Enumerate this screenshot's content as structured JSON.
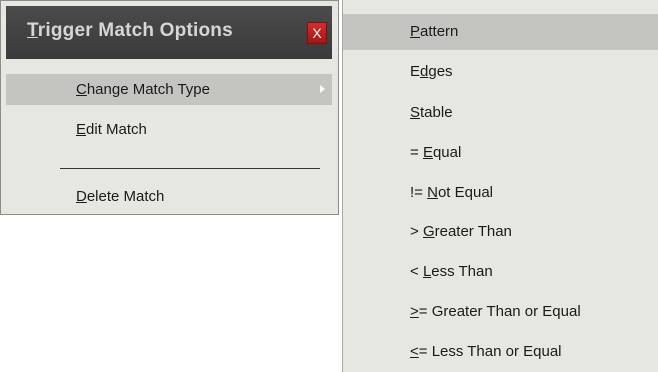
{
  "context_menu": {
    "title_mnemonic": "T",
    "title_rest": "rigger Match Options",
    "close_label": "X",
    "items": [
      {
        "mnemonic": "C",
        "rest": "hange Match Type",
        "has_submenu": true,
        "active": true
      },
      {
        "mnemonic": "E",
        "rest": "dit Match",
        "has_submenu": false,
        "active": false
      },
      {
        "mnemonic": "D",
        "rest": "elete Match",
        "has_submenu": false,
        "active": false
      }
    ]
  },
  "submenu": {
    "items": [
      {
        "before": "",
        "mnemonic": "P",
        "after": "attern",
        "active": true
      },
      {
        "before": "E",
        "mnemonic": "d",
        "after": "ges",
        "active": false
      },
      {
        "before": "",
        "mnemonic": "S",
        "after": "table",
        "active": false
      },
      {
        "before": "= ",
        "mnemonic": "E",
        "after": "qual",
        "active": false
      },
      {
        "before": "!= ",
        "mnemonic": "N",
        "after": "ot Equal",
        "active": false
      },
      {
        "before": "> ",
        "mnemonic": "G",
        "after": "reater Than",
        "active": false
      },
      {
        "before": "< ",
        "mnemonic": "L",
        "after": "ess Than",
        "active": false
      },
      {
        "before": "",
        "mnemonic": ">",
        "after": "= Greater Than or Equal",
        "active": false
      },
      {
        "before": "",
        "mnemonic": "<",
        "after": "= Less Than or Equal",
        "active": false
      }
    ]
  },
  "colors": {
    "menu_bg": "#e7e7e2",
    "highlight_bg": "#c4c5c1",
    "header_bg": "#3f3f3f",
    "header_text": "#d6d6d6",
    "close_bg": "#c32020"
  }
}
